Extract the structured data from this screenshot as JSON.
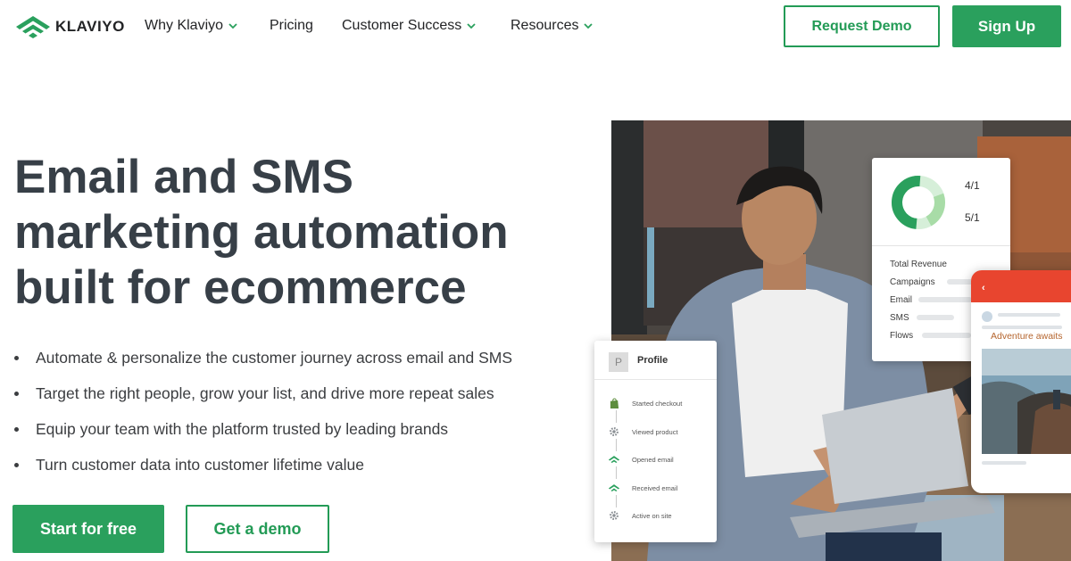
{
  "header": {
    "brand": "KLAVIYO",
    "nav": [
      {
        "label": "Why Klaviyo"
      },
      {
        "label": "Pricing"
      },
      {
        "label": "Customer Success"
      },
      {
        "label": "Resources"
      }
    ],
    "request_demo": "Request Demo",
    "sign_up": "Sign Up"
  },
  "hero": {
    "title_lines": [
      "Email and SMS",
      "marketing automation",
      "built for ecommerce"
    ],
    "bullets": [
      "Automate & personalize the customer journey across email and SMS",
      "Target the right people, grow your list, and drive more repeat sales",
      "Equip your team with the platform trusted by leading brands",
      "Turn customer data into customer lifetime value"
    ],
    "cta_primary": "Start for free",
    "cta_secondary": "Get a demo"
  },
  "revenue_card": {
    "values": [
      "4/1",
      "5/1"
    ],
    "labels": [
      "Total Revenue",
      "Campaigns",
      "Email",
      "SMS",
      "Flows"
    ]
  },
  "profile_card": {
    "avatar_letter": "P",
    "title": "Profile",
    "events": [
      {
        "label": "Started checkout",
        "icon": "shopify-icon"
      },
      {
        "label": "Viewed product",
        "icon": "gear-icon"
      },
      {
        "label": "Opened email",
        "icon": "klaviyo-flag-icon"
      },
      {
        "label": "Received email",
        "icon": "klaviyo-flag-icon"
      },
      {
        "label": "Active on site",
        "icon": "gear-icon"
      }
    ]
  },
  "phone": {
    "headline": "Adventure awaits"
  },
  "colors": {
    "brand_green": "#2aa05d",
    "heading": "#373f47",
    "phone_red": "#e8452f"
  }
}
